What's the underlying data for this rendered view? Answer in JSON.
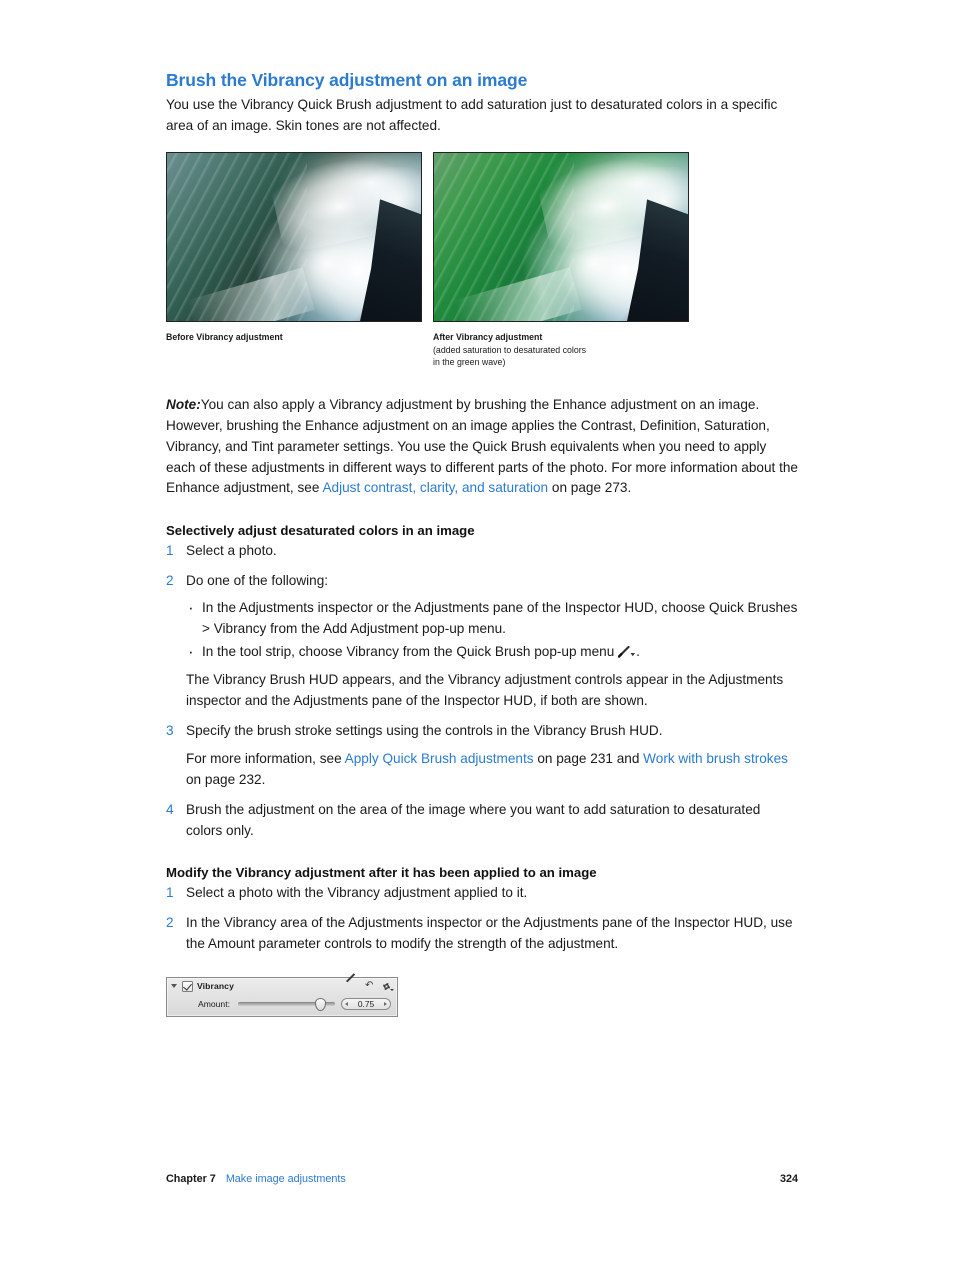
{
  "page": {
    "heading": "Brush the Vibrancy adjustment on an image",
    "intro": "You use the Vibrancy Quick Brush adjustment to add saturation just to desaturated colors in a specific area of an image. Skin tones are not affected.",
    "accent_color": "#2b7bd0",
    "text_color": "#1a1a1a"
  },
  "figures": [
    {
      "alt": "Ocean wave photograph before Vibrancy adjustment",
      "caption_title": "Before Vibrancy adjustment",
      "caption_sub": ""
    },
    {
      "alt": "Ocean wave photograph after Vibrancy adjustment with more saturated green",
      "caption_title": "After Vibrancy adjustment",
      "caption_sub": "(added saturation to desaturated colors\nin the green wave)"
    }
  ],
  "note": {
    "label": "Note:",
    "text_1": "You can also apply a Vibrancy adjustment by brushing the Enhance adjustment on an image. However, brushing the Enhance adjustment on an image applies the Contrast, Definition, Saturation, Vibrancy, and Tint parameter settings. You use the Quick Brush equivalents when you need to apply each of these adjustments in different ways to different parts of the photo. For more information about the Enhance adjustment, see ",
    "link": "Adjust contrast, clarity, and saturation",
    "text_2": " on page 273."
  },
  "procedure_1": {
    "title": "Selectively adjust desaturated colors in an image",
    "steps": [
      {
        "num": "1",
        "text": "Select a photo."
      },
      {
        "num": "2",
        "text": "Do one of the following:",
        "bullets": [
          "In the Adjustments inspector or the Adjustments pane of the Inspector HUD, choose Quick Brushes > Vibrancy from the Add Adjustment pop-up menu.",
          "In the tool strip, choose Vibrancy from the Quick Brush pop-up menu "
        ],
        "bullet_2_suffix": ".",
        "follow_up": "The Vibrancy Brush HUD appears, and the Vibrancy adjustment controls appear in the Adjustments inspector and the Adjustments pane of the Inspector HUD, if both are shown."
      },
      {
        "num": "3",
        "text": "Specify the brush stroke settings using the controls in the Vibrancy Brush HUD.",
        "follow_up_pre": "For more information, see ",
        "follow_up_link_1": "Apply Quick Brush adjustments",
        "follow_up_mid": " on page 231 and ",
        "follow_up_link_2": "Work with brush strokes",
        "follow_up_post": " on page 232."
      },
      {
        "num": "4",
        "text": "Brush the adjustment on the area of the image where you want to add saturation to desaturated colors only."
      }
    ]
  },
  "procedure_2": {
    "title": "Modify the Vibrancy adjustment after it has been applied to an image",
    "steps": [
      {
        "num": "1",
        "text": "Select a photo with the Vibrancy adjustment applied to it."
      },
      {
        "num": "2",
        "text": "In the Vibrancy area of the Adjustments inspector or the Adjustments pane of the Inspector HUD, use the Amount parameter controls to modify the strength of the adjustment."
      }
    ]
  },
  "vibrancy_panel": {
    "title": "Vibrancy",
    "checkbox_checked": "true",
    "disclosure_state": "expanded",
    "amount_label": "Amount:",
    "amount_value": "0.75",
    "slider_percent": "84",
    "icons": [
      "brush-icon",
      "reset-icon",
      "action-gear-icon"
    ]
  },
  "footer": {
    "chapter": "Chapter 7",
    "chapter_title": "Make image adjustments",
    "page_number": "324"
  }
}
